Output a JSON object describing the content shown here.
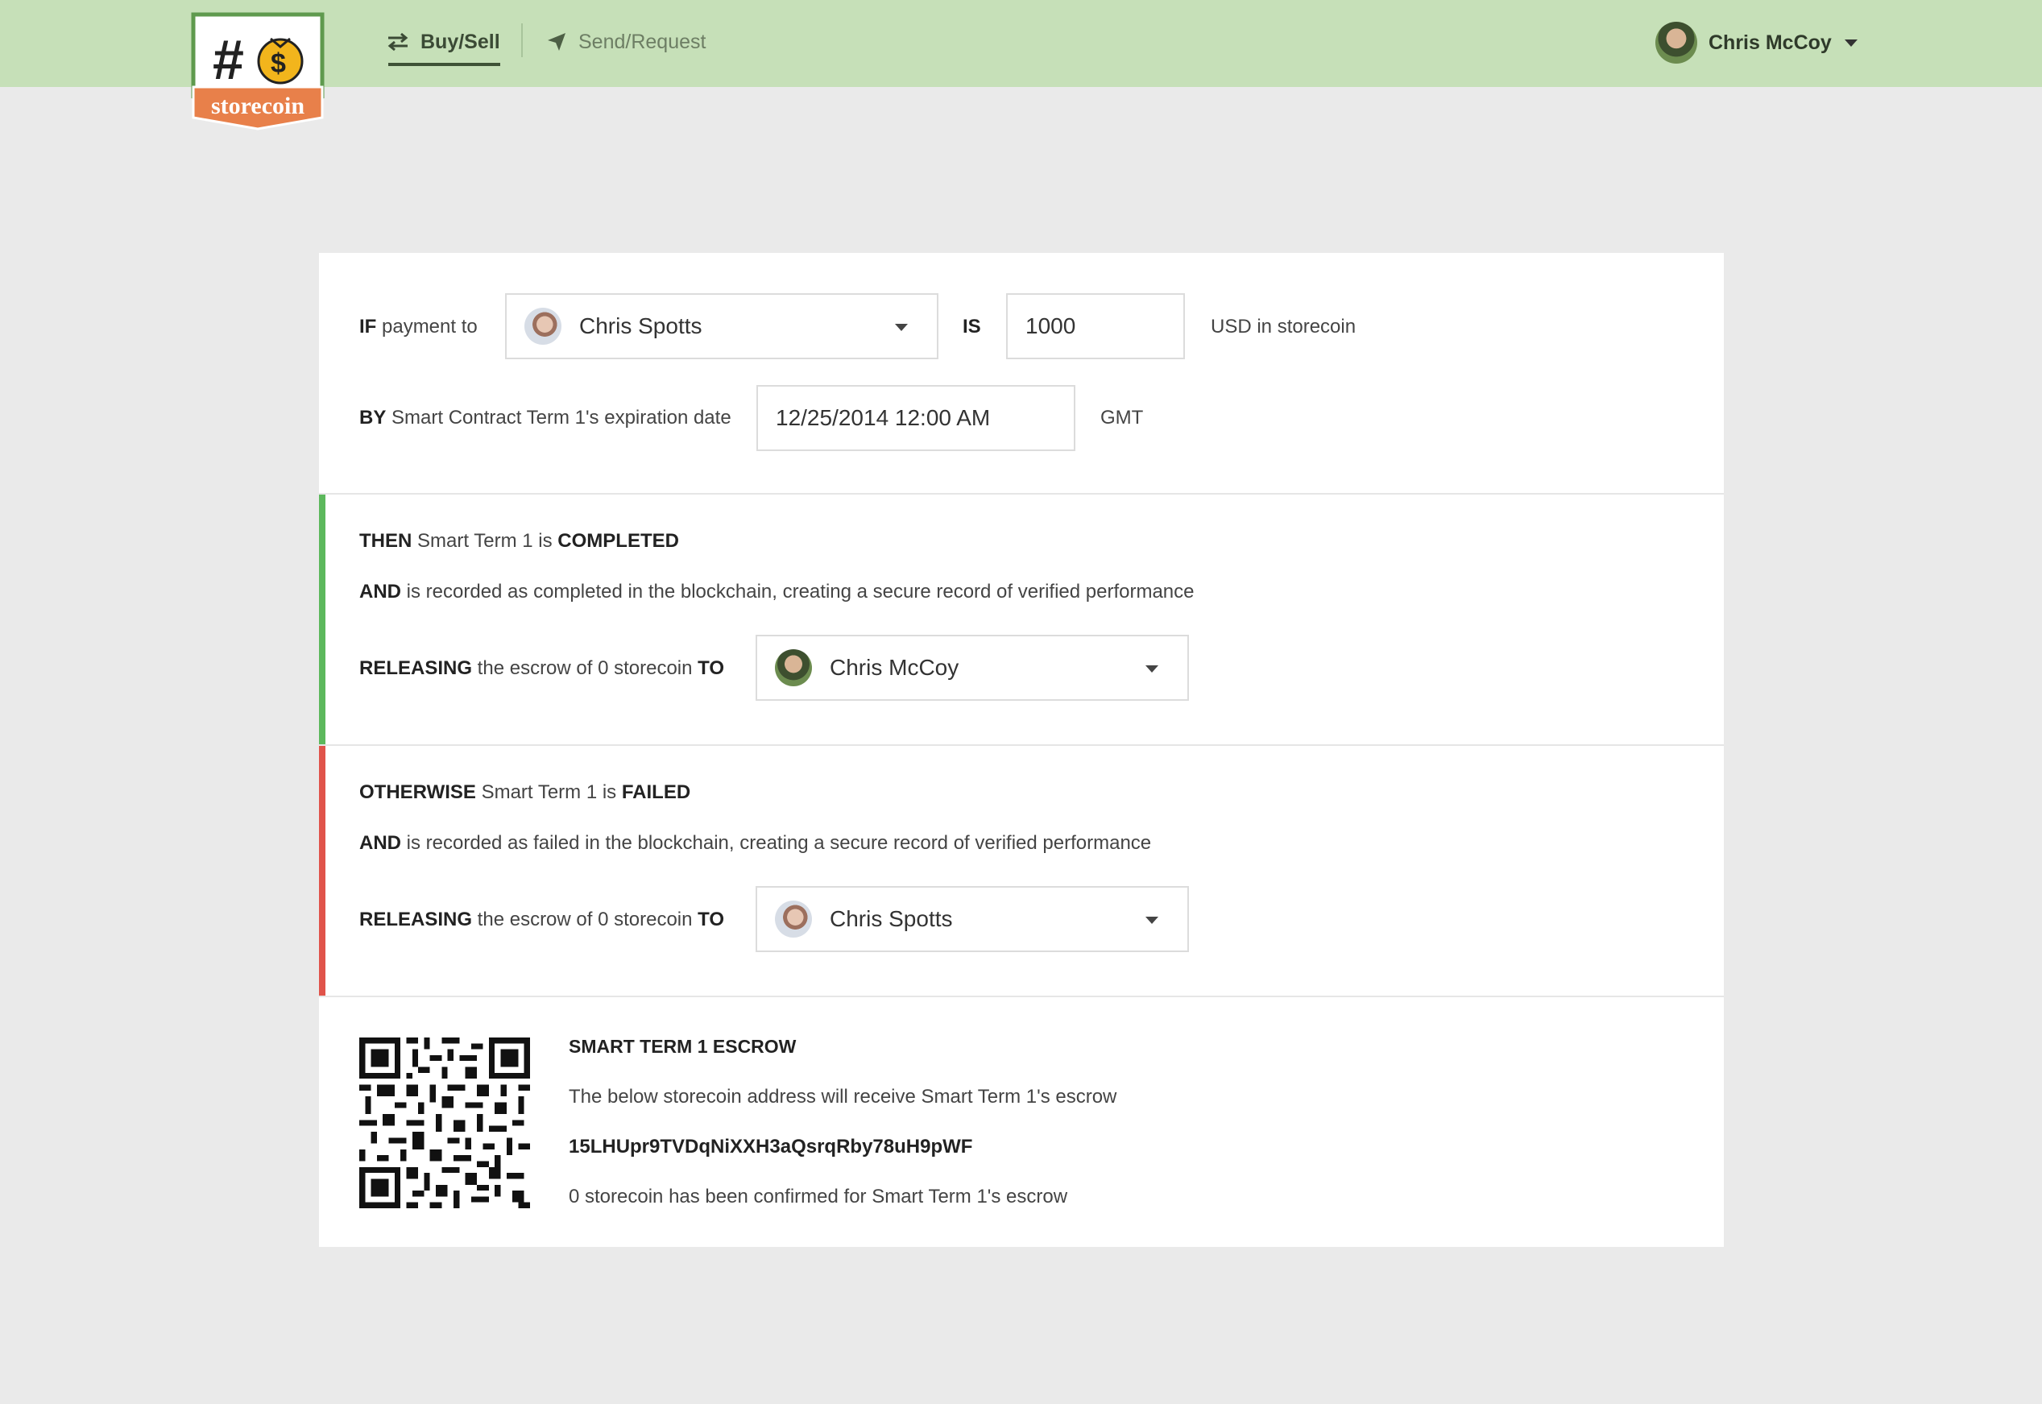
{
  "app": {
    "logo_text": "storecoin",
    "logo_symbol": "#$"
  },
  "nav": {
    "items": [
      {
        "label": "Buy/Sell",
        "active": true
      },
      {
        "label": "Send/Request",
        "active": false
      }
    ]
  },
  "user": {
    "name": "Chris McCoy"
  },
  "if_section": {
    "if_kw": "IF",
    "payment_to_text": " payment to",
    "payee": "Chris Spotts",
    "is_kw": "IS",
    "amount": "1000",
    "currency_text": "USD in storecoin",
    "by_kw": "BY",
    "by_text": " Smart Contract Term 1's expiration date",
    "date": "12/25/2014 12:00 AM",
    "timezone": "GMT"
  },
  "then_section": {
    "then_kw": "THEN",
    "term_text": " Smart Term 1 is ",
    "status_kw": "COMPLETED",
    "and_kw": "AND",
    "and_text": " is recorded as completed in the blockchain, creating a secure record of verified performance",
    "releasing_kw": "RELEASING",
    "releasing_text": " the escrow of 0 storecoin ",
    "to_kw": "TO",
    "recipient": "Chris McCoy"
  },
  "else_section": {
    "else_kw": "OTHERWISE",
    "term_text": " Smart Term 1 is ",
    "status_kw": "FAILED",
    "and_kw": "AND",
    "and_text": " is recorded as failed in the blockchain, creating a secure record of verified performance",
    "releasing_kw": "RELEASING",
    "releasing_text": " the escrow of 0 storecoin ",
    "to_kw": "TO",
    "recipient": "Chris Spotts"
  },
  "escrow": {
    "title": "SMART TERM 1 ESCROW",
    "description": "The below storecoin address will receive Smart Term 1's escrow",
    "address": "15LHUpr9TVDqNiXXH3aQsrqRby78uH9pWF",
    "confirmed_text": "0 storecoin has been confirmed for Smart Term 1's escrow"
  },
  "colors": {
    "topbar": "#c6e0b8",
    "completed_accent": "#5cb85c",
    "failed_accent": "#e0534a",
    "logo_banner": "#e8804a"
  },
  "icons": {
    "buy_sell": "arrows-exchange-icon",
    "send_request": "paper-plane-icon",
    "dropdown": "caret-down-icon"
  }
}
